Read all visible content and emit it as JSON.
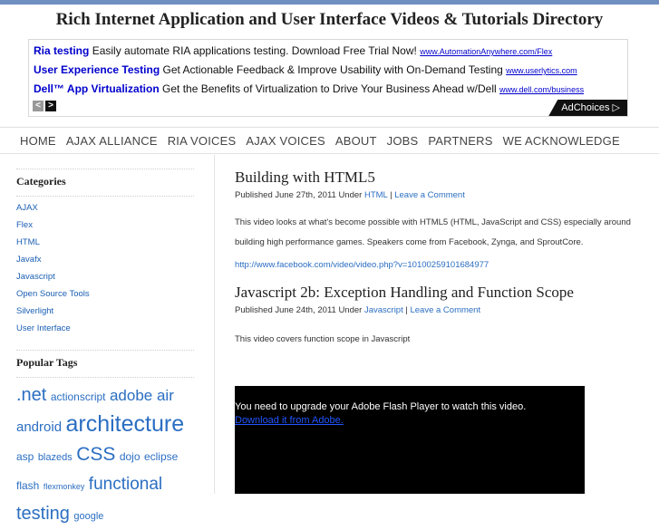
{
  "site": {
    "title": "Rich Internet Application and User Interface Videos & Tutorials Directory"
  },
  "ads": [
    {
      "headline": "Ria testing",
      "text": "Easily automate RIA applications testing. Download Free Trial Now!",
      "url": "www.AutomationAnywhere.com/Flex"
    },
    {
      "headline": "User Experience Testing",
      "text": "Get Actionable Feedback & Improve Usability with On-Demand Testing",
      "url": "www.userlytics.com"
    },
    {
      "headline": "Dell™ App Virtualization",
      "text": "Get the Benefits of Virtualization to Drive Your Business Ahead w/Dell",
      "url": "www.dell.com/business"
    }
  ],
  "ad_controls": {
    "prev_glyph": "<",
    "next_glyph": ">",
    "adchoices": "AdChoices ▷"
  },
  "nav": [
    "HOME",
    "AJAX ALLIANCE",
    "RIA VOICES",
    "AJAX VOICES",
    "ABOUT",
    "JOBS",
    "PARTNERS",
    "WE ACKNOWLEDGE"
  ],
  "sidebar": {
    "categories_title": "Categories",
    "categories": [
      "AJAX",
      "Flex",
      "HTML",
      "Javafx",
      "Javascript",
      "Open Source Tools",
      "Silverlight",
      "User Interface"
    ],
    "tags_title": "Popular Tags",
    "tags": [
      {
        "text": ".net",
        "size": 20
      },
      {
        "text": "actionscript",
        "size": 12
      },
      {
        "text": "adobe air",
        "size": 17
      },
      {
        "text": "android",
        "size": 15
      },
      {
        "text": "architecture",
        "size": 25
      },
      {
        "text": "asp",
        "size": 12
      },
      {
        "text": "blazeds",
        "size": 11
      },
      {
        "text": "CSS",
        "size": 21
      },
      {
        "text": "dojo",
        "size": 12
      },
      {
        "text": "eclipse",
        "size": 12
      },
      {
        "text": "flash",
        "size": 12
      },
      {
        "text": "flexmonkey",
        "size": 9
      },
      {
        "text": "functional",
        "size": 19
      },
      {
        "text": "testing",
        "size": 20
      },
      {
        "text": "google",
        "size": 11
      }
    ]
  },
  "posts": [
    {
      "title": "Building with HTML5",
      "meta_prefix": "Published June 27th, 2011 Under ",
      "category": "HTML",
      "sep": " | ",
      "comment": "Leave a Comment",
      "body": "This video looks at what's become possible with HTML5 (HTML, JavaScript and CSS) especially around building high performance games. Speakers come from Facebook, Zynga, and SproutCore.",
      "link": "http://www.facebook.com/video/video.php?v=10100259101684977"
    },
    {
      "title": "Javascript 2b: Exception Handling and Function Scope",
      "meta_prefix": "Published June 24th, 2011 Under ",
      "category": "Javascript",
      "sep": " | ",
      "comment": "Leave a Comment",
      "body": "This video covers function scope in Javascript"
    }
  ],
  "flash": {
    "message": "You need to upgrade your Adobe Flash Player to watch this video.",
    "download": "Download it from Adobe."
  },
  "colors": {
    "link": "#2b6ec2",
    "ad_link": "#0000cc",
    "topbar": "#6f8fc0"
  }
}
